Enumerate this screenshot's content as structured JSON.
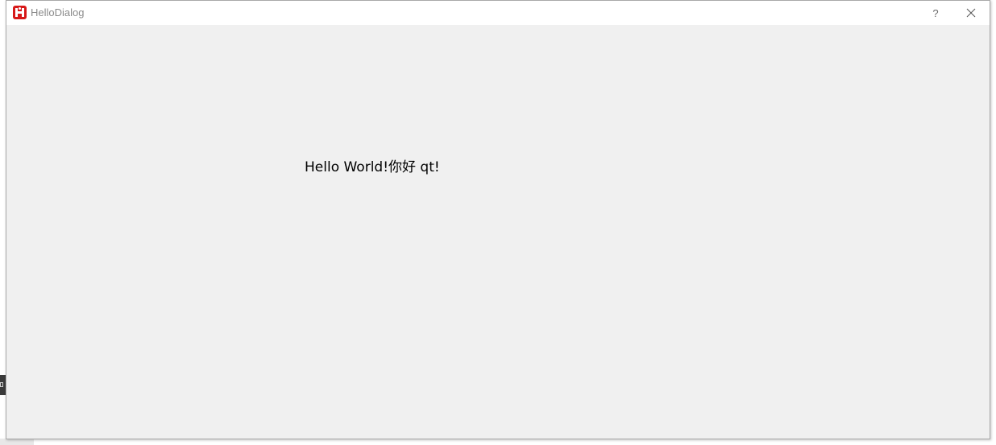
{
  "window": {
    "title": "HelloDialog",
    "help_label": "?",
    "icons": {
      "app": "app-logo-icon",
      "help": "help-icon",
      "close": "close-icon"
    }
  },
  "content": {
    "label_text": "Hello World!你好 qt!"
  },
  "colors": {
    "titlebar_bg": "#ffffff",
    "client_bg": "#f0f0f0",
    "app_icon_red": "#d71818",
    "title_text": "#8a8a8a"
  }
}
